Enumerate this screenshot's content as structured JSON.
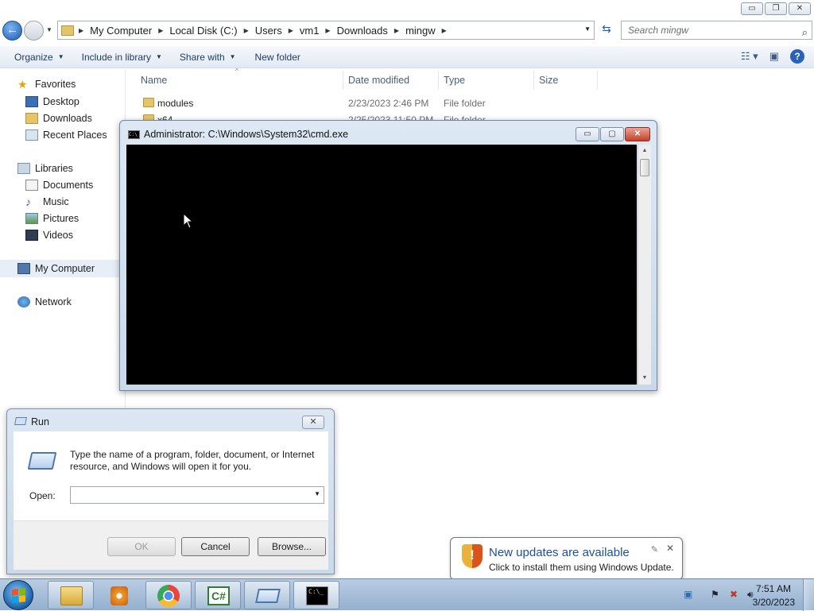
{
  "explorer": {
    "window_controls": {
      "minimize": "▭",
      "maximize": "❐",
      "close": "✕"
    },
    "breadcrumbs": [
      "My Computer",
      "Local Disk (C:)",
      "Users",
      "vm1",
      "Downloads",
      "mingw"
    ],
    "search_placeholder": "Search mingw",
    "toolbar": {
      "organize": "Organize",
      "include_in_library": "Include in library",
      "share_with": "Share with",
      "new_folder": "New folder"
    },
    "nav": {
      "favorites": "Favorites",
      "desktop": "Desktop",
      "downloads": "Downloads",
      "recent_places": "Recent Places",
      "libraries": "Libraries",
      "documents": "Documents",
      "music": "Music",
      "pictures": "Pictures",
      "videos": "Videos",
      "my_computer": "My Computer",
      "network": "Network"
    },
    "columns": [
      "Name",
      "Date modified",
      "Type",
      "Size"
    ],
    "files": [
      {
        "name": "modules",
        "date": "2/23/2023 2:46 PM",
        "type": "File folder",
        "size": ""
      },
      {
        "name": "x64",
        "date": "2/25/2023 11:50 PM",
        "type": "File folder",
        "size": ""
      }
    ]
  },
  "cmd": {
    "title": "Administrator: C:\\Windows\\System32\\cmd.exe",
    "icon_text": "C:\\"
  },
  "run": {
    "title": "Run",
    "description": "Type the name of a program, folder, document, or Internet resource, and Windows will open it for you.",
    "open_label": "Open:",
    "open_value": "",
    "ok": "OK",
    "cancel": "Cancel",
    "browse": "Browse..."
  },
  "notification": {
    "title": "New updates are available",
    "text": "Click to install them using Windows Update."
  },
  "taskbar": {
    "time": "7:51 AM",
    "date": "3/20/2023",
    "apps": [
      "file-explorer",
      "media-player",
      "chrome",
      "csharp-ide",
      "run-dialog",
      "command-prompt"
    ]
  },
  "colors": {
    "cmd_background": "#000000",
    "notification_title": "#1d4f9a",
    "taskbar": "#a9c1dc"
  }
}
